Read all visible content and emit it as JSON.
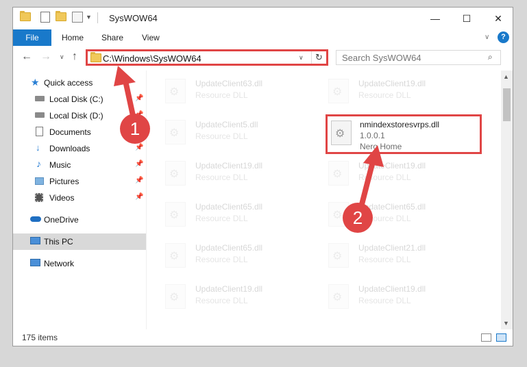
{
  "window": {
    "title": "SysWOW64",
    "controls": {
      "minimize": "—",
      "maximize": "☐",
      "close": "✕"
    }
  },
  "ribbon": {
    "tabs": [
      {
        "label": "File"
      },
      {
        "label": "Home"
      },
      {
        "label": "Share"
      },
      {
        "label": "View"
      }
    ]
  },
  "navigation": {
    "address": "C:\\Windows\\SysWOW64",
    "search_placeholder": "Search SysWOW64"
  },
  "sidebar": {
    "items": [
      {
        "label": "Quick access"
      },
      {
        "label": "Local Disk (C:)"
      },
      {
        "label": "Local Disk (D:)"
      },
      {
        "label": "Documents"
      },
      {
        "label": "Downloads"
      },
      {
        "label": "Music"
      },
      {
        "label": "Pictures"
      },
      {
        "label": "Videos"
      },
      {
        "label": "OneDrive"
      },
      {
        "label": "This PC"
      },
      {
        "label": "Network"
      }
    ]
  },
  "files": [
    {
      "name": "UpdateClient63.dll",
      "desc": "Resource DLL"
    },
    {
      "name": "UpdateClient19.dll",
      "desc": "Resource DLL"
    },
    {
      "name": "UpdateClient5.dll",
      "desc": "Resource DLL"
    },
    {
      "name": "nmindexstoresvrps.dll",
      "version": "1.0.0.1",
      "desc": "Nero Home"
    },
    {
      "name": "UpdateClient19.dll",
      "desc": "Resource DLL"
    },
    {
      "name": "UpdateClient19.dll",
      "desc": "Resource DLL"
    },
    {
      "name": "UpdateClient65.dll",
      "desc": "Resource DLL"
    },
    {
      "name": "UpdateClient65.dll",
      "desc": "Resource DLL"
    },
    {
      "name": "UpdateClient65.dll",
      "desc": "Resource DLL"
    },
    {
      "name": "UpdateClient21.dll",
      "desc": "Resource DLL"
    },
    {
      "name": "UpdateClient19.dll",
      "desc": "Resource DLL"
    },
    {
      "name": "UpdateClient19.dll",
      "desc": "Resource DLL"
    }
  ],
  "status": {
    "item_count": "175 items"
  },
  "annotations": {
    "step1": "1",
    "step2": "2"
  },
  "colors": {
    "accent": "#1979ca",
    "annotation": "#e04545"
  }
}
